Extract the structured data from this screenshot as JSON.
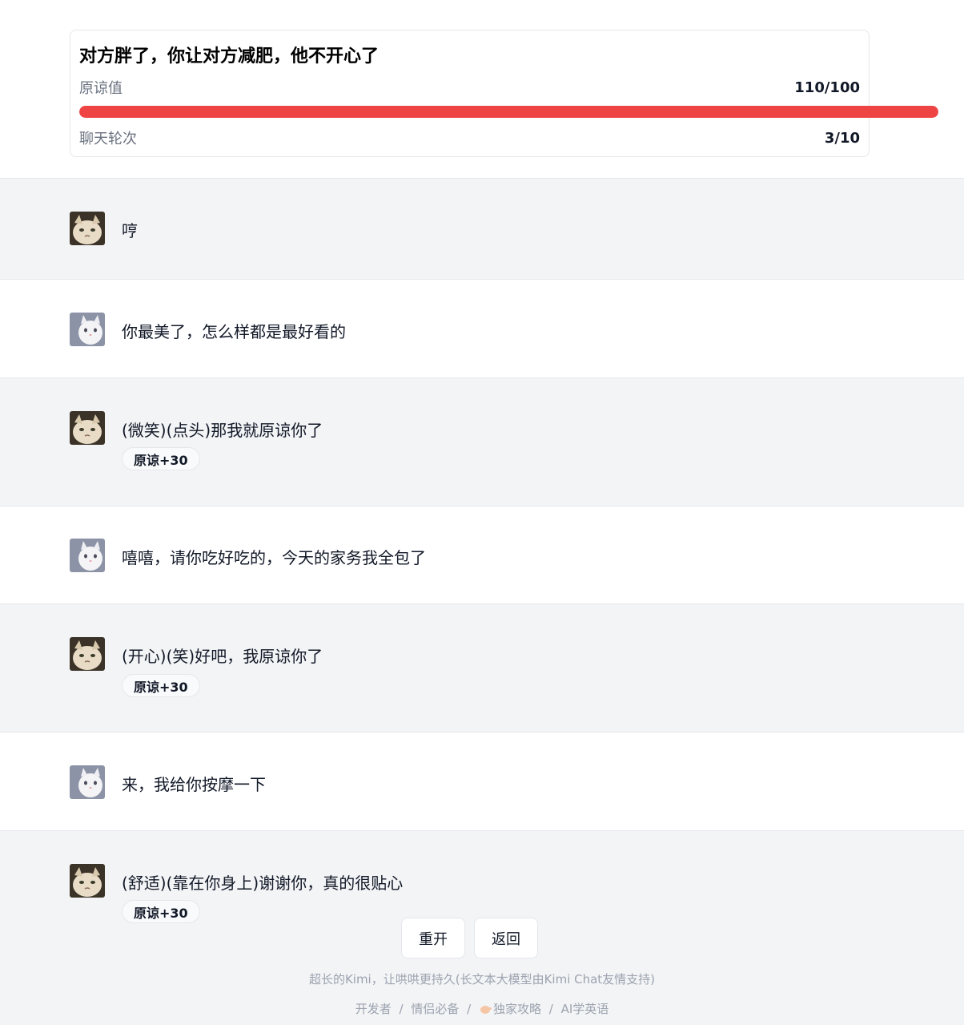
{
  "header": {
    "title": "对方胖了，你让对方减肥，他不开心了",
    "forgiveness_label": "原谅值",
    "forgiveness_value": "110/100",
    "forgiveness_fraction": 1.0,
    "rounds_label": "聊天轮次",
    "rounds_value": "3/10"
  },
  "messages": [
    {
      "role": "partner",
      "text": "哼",
      "avatar": "grumpy-cat-avatar"
    },
    {
      "role": "user",
      "text": "你最美了，怎么样都是最好看的",
      "avatar": "white-cat-avatar"
    },
    {
      "role": "partner",
      "text": "(微笑)(点头)那我就原谅你了",
      "badge": "原谅+30",
      "avatar": "grumpy-cat-avatar"
    },
    {
      "role": "user",
      "text": "嘻嘻，请你吃好吃的，今天的家务我全包了",
      "avatar": "white-cat-avatar"
    },
    {
      "role": "partner",
      "text": "(开心)(笑)好吧，我原谅你了",
      "badge": "原谅+30",
      "avatar": "grumpy-cat-avatar"
    },
    {
      "role": "user",
      "text": "来，我给你按摩一下",
      "avatar": "white-cat-avatar"
    },
    {
      "role": "partner",
      "text": "(舒适)(靠在你身上)谢谢你，真的很贴心",
      "badge": "原谅+30",
      "avatar": "grumpy-cat-avatar"
    }
  ],
  "actions": {
    "restart_label": "重开",
    "back_label": "返回"
  },
  "footer": {
    "note": "超长的Kimi，让哄哄更持久(长文本大模型由Kimi Chat友情支持)",
    "links": [
      "开发者",
      "情侣必备",
      "独家攻略",
      "AI学英语"
    ],
    "separator": "/"
  },
  "colors": {
    "progress": "#ef4444",
    "partner_bg": "#f3f4f6",
    "user_bg": "#ffffff"
  }
}
